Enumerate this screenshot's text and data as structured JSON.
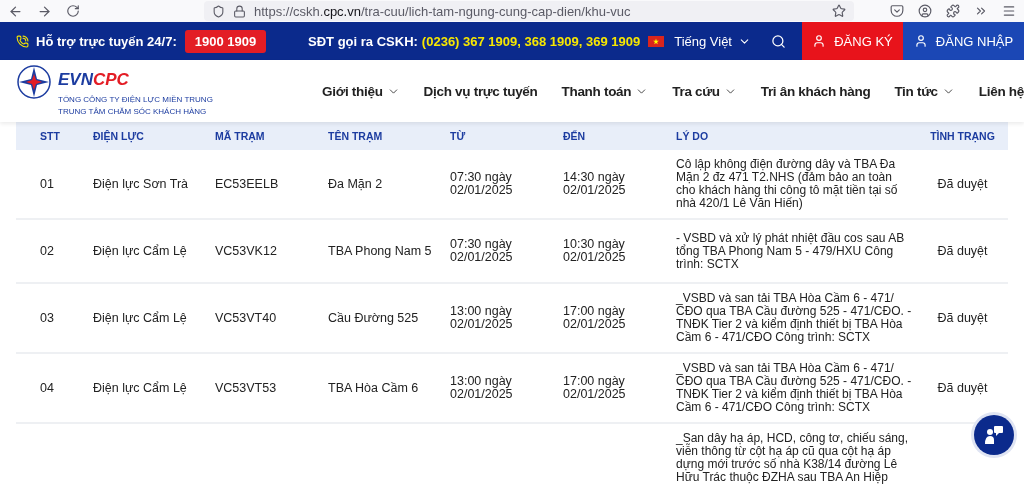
{
  "browser": {
    "url_host": "https://cskh.",
    "url_domain": "cpc.vn",
    "url_path": "/tra-cuu/lich-tam-ngung-cung-cap-dien/khu-vuc"
  },
  "topbar": {
    "support_label": "Hỗ trợ trực tuyến 24/7:",
    "hotline": "1900 1909",
    "cskh_label": "SĐT gọi ra CSKH:",
    "cskh_numbers": "(0236) 367 1909, 368 1909, 369 1909",
    "language": "Tiếng Việt",
    "buttons": [
      {
        "kind": "register",
        "label": "ĐĂNG KÝ"
      },
      {
        "kind": "login",
        "label": "ĐĂNG NHẬP"
      }
    ]
  },
  "logo": {
    "brand_a": "EVN",
    "brand_b": "CPC",
    "line_1": "TỔNG CÔNG TY ĐIỆN LỰC MIỀN TRUNG",
    "line_2": "TRUNG TÂM CHĂM SÓC KHÁCH HÀNG"
  },
  "nav": [
    {
      "label": "Giới thiệu",
      "dropdown": true
    },
    {
      "label": "Dịch vụ trực tuyến",
      "dropdown": false
    },
    {
      "label": "Thanh toán",
      "dropdown": true
    },
    {
      "label": "Tra cứu",
      "dropdown": true
    },
    {
      "label": "Tri ân khách hàng",
      "dropdown": false
    },
    {
      "label": "Tin tức",
      "dropdown": true
    },
    {
      "label": "Liên hệ",
      "dropdown": false
    }
  ],
  "table": {
    "columns": [
      "STT",
      "ĐIỆN LỰC",
      "MÃ TRẠM",
      "TÊN TRẠM",
      "TỪ",
      "ĐẾN",
      "LÝ DO",
      "TÌNH TRẠNG"
    ],
    "rows": [
      {
        "stt": "01",
        "unit": "Điện lực Sơn Trà",
        "code": "EC53EELB",
        "station": "Đa Mặn 2",
        "from": [
          "07:30 ngày",
          "02/01/2025"
        ],
        "to": [
          "14:30 ngày",
          "02/01/2025"
        ],
        "reason": [
          "Cô lập không điện đường dây và TBA Đa",
          "Mặn 2 đz 471 T2.NHS (đảm bảo an toàn",
          "cho khách hàng thi công tô mặt tiền tại số",
          "nhà 420/1 Lê Văn Hiến)"
        ],
        "status": "Đã duyệt"
      },
      {
        "stt": "02",
        "unit": "Điện lực Cẩm Lệ",
        "code": "VC53VK12",
        "station": "TBA Phong Nam 5",
        "from": [
          "07:30 ngày",
          "02/01/2025"
        ],
        "to": [
          "10:30 ngày",
          "02/01/2025"
        ],
        "reason": [
          "- VSBD và xử lý phát nhiệt đầu cos sau AB",
          "tổng TBA Phong Nam 5 - 479/HXU Công",
          "trình: SCTX"
        ],
        "status": "Đã duyệt"
      },
      {
        "stt": "03",
        "unit": "Điện lực Cẩm Lệ",
        "code": "VC53VT40",
        "station": "Cầu Đường 525",
        "from": [
          "13:00 ngày",
          "02/01/2025"
        ],
        "to": [
          "17:00 ngày",
          "02/01/2025"
        ],
        "reason": [
          "_VSBD và san tải TBA Hòa Cầm 6 - 471/",
          "CĐO qua TBA Cầu đường 525 - 471/CĐO. -",
          "TNĐK Tier 2 và kiểm định thiết bị TBA Hòa",
          "Cầm 6 - 471/CĐO Công trình: SCTX"
        ],
        "status": "Đã duyệt"
      },
      {
        "stt": "04",
        "unit": "Điện lực Cẩm Lệ",
        "code": "VC53VT53",
        "station": "TBA Hòa Cầm 6",
        "from": [
          "13:00 ngày",
          "02/01/2025"
        ],
        "to": [
          "17:00 ngày",
          "02/01/2025"
        ],
        "reason": [
          "_VSBD và san tải TBA Hòa Cầm 6 - 471/",
          "CĐO qua TBA Cầu đường 525 - 471/CĐO. -",
          "TNĐK Tier 2 và kiểm định thiết bị TBA Hòa",
          "Cầm 6 - 471/CĐO Công trình: SCTX"
        ],
        "status": "Đã duyệt"
      },
      {
        "reason": [
          "_San dây hạ áp, HCD, công tơ, chiếu sáng,",
          "viễn thông từ cột hạ áp cũ qua cột hạ áp",
          "dựng mới trước số nhà K38/14 đường Lê",
          "Hữu Trác thuộc ĐZHA sau TBA An Hiệp"
        ]
      }
    ]
  }
}
